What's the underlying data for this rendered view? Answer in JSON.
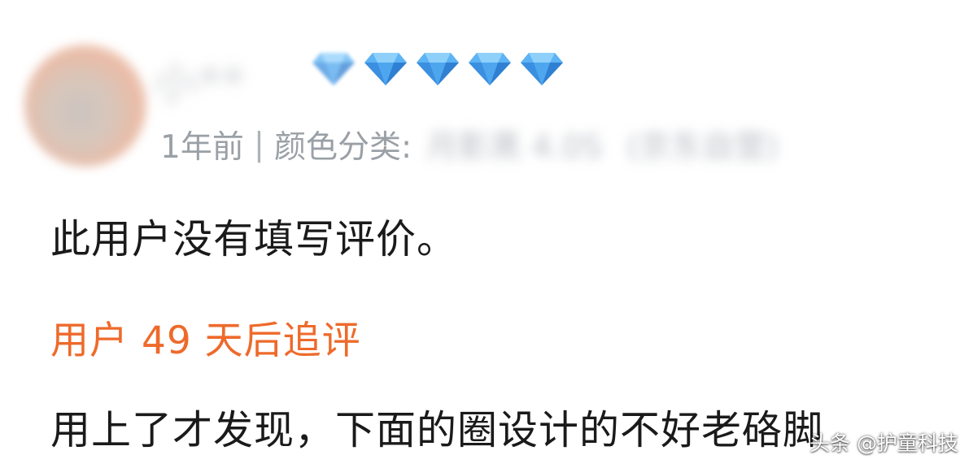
{
  "user": {
    "name": "小**",
    "diamond_count": 5,
    "diamond_color": "#4aa3f0"
  },
  "meta": {
    "time": "1年前",
    "separator": "|",
    "color_label": "颜色分类:",
    "variant": "月影黑 4.0S",
    "variant_extra": "(京东自营)"
  },
  "review": {
    "text": "此用户没有填写评价。"
  },
  "followup": {
    "title": "用户 49 天后追评",
    "title_color": "#ee6a2b",
    "text": "用上了才发现，下面的圈设计的不好老硌脚"
  },
  "watermark": {
    "text": "头条 @护童科技"
  }
}
